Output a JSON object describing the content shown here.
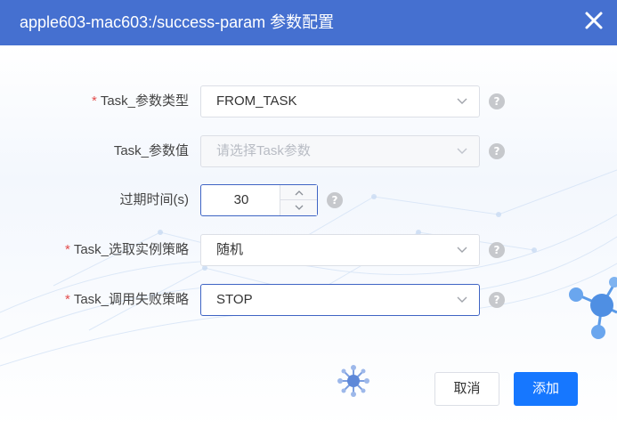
{
  "dialog": {
    "title": "apple603-mac603:/success-param 参数配置"
  },
  "form": {
    "param_type": {
      "required": "*",
      "label": "Task_参数类型",
      "value": "FROM_TASK"
    },
    "param_value": {
      "label": "Task_参数值",
      "placeholder": "请选择Task参数"
    },
    "timeout": {
      "label": "过期时间(s)",
      "value": "30"
    },
    "instance_strategy": {
      "required": "*",
      "label": "Task_选取实例策略",
      "value": "随机"
    },
    "fail_strategy": {
      "required": "*",
      "label": "Task_调用失败策略",
      "value": "STOP"
    },
    "help_glyph": "?"
  },
  "footer": {
    "cancel_label": "取消",
    "confirm_label": "添加"
  },
  "colors": {
    "header_bg": "#4570d0",
    "primary": "#1677ff",
    "required": "#e34d4d"
  },
  "icons": [
    "close-icon",
    "chevron-down-icon",
    "help-icon",
    "arrow-up-icon",
    "arrow-down-icon",
    "network-node-decoration"
  ]
}
